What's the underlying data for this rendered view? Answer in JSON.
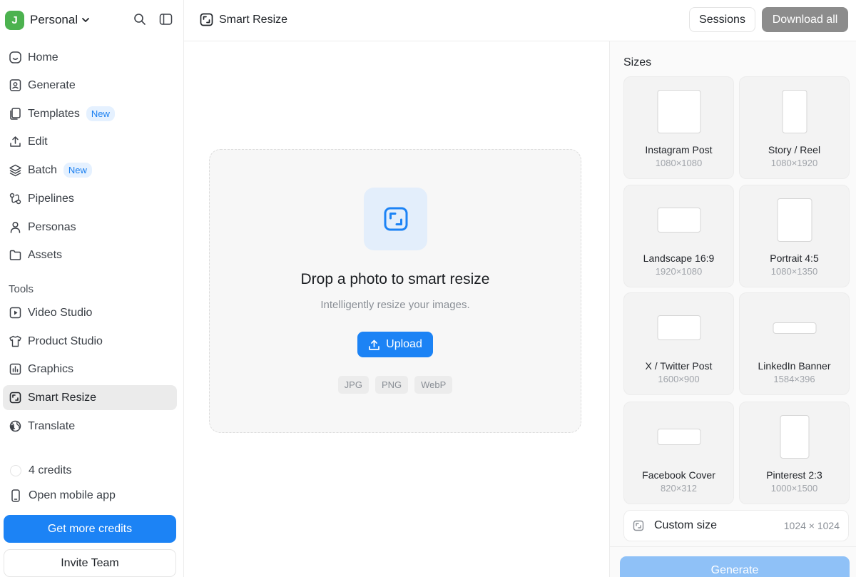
{
  "workspace": {
    "avatar_letter": "J",
    "name": "Personal"
  },
  "sidebar": {
    "nav": [
      {
        "label": "Home",
        "icon": "home-icon"
      },
      {
        "label": "Generate",
        "icon": "image-icon"
      },
      {
        "label": "Templates",
        "icon": "templates-icon",
        "badge": "New"
      },
      {
        "label": "Edit",
        "icon": "upload-icon"
      },
      {
        "label": "Batch",
        "icon": "layers-icon",
        "badge": "New"
      },
      {
        "label": "Pipelines",
        "icon": "pipeline-icon"
      },
      {
        "label": "Personas",
        "icon": "person-icon"
      },
      {
        "label": "Assets",
        "icon": "folder-icon"
      }
    ],
    "tools_label": "Tools",
    "tools": [
      {
        "label": "Video Studio",
        "icon": "play-icon"
      },
      {
        "label": "Product Studio",
        "icon": "shirt-icon"
      },
      {
        "label": "Graphics",
        "icon": "bar-chart-icon"
      },
      {
        "label": "Smart Resize",
        "icon": "resize-icon",
        "active": true
      },
      {
        "label": "Translate",
        "icon": "globe-icon"
      }
    ],
    "credits": "4 credits",
    "mobile_app": "Open mobile app",
    "get_credits": "Get more credits",
    "invite": "Invite Team"
  },
  "header": {
    "title": "Smart Resize",
    "sessions": "Sessions",
    "download_all": "Download all"
  },
  "dropzone": {
    "title": "Drop a photo to smart resize",
    "subtitle": "Intelligently resize your images.",
    "upload": "Upload",
    "formats": [
      "JPG",
      "PNG",
      "WebP"
    ]
  },
  "sizes": {
    "title": "Sizes",
    "items": [
      {
        "name": "Instagram Post",
        "dim": "1080×1080"
      },
      {
        "name": "Story / Reel",
        "dim": "1080×1920"
      },
      {
        "name": "Landscape 16:9",
        "dim": "1920×1080"
      },
      {
        "name": "Portrait 4:5",
        "dim": "1080×1350"
      },
      {
        "name": "X / Twitter Post",
        "dim": "1600×900"
      },
      {
        "name": "LinkedIn Banner",
        "dim": "1584×396"
      },
      {
        "name": "Facebook Cover",
        "dim": "820×312"
      },
      {
        "name": "Pinterest 2:3",
        "dim": "1000×1500"
      }
    ],
    "custom_label": "Custom size",
    "custom_value": "1024 × 1024",
    "generate": "Generate"
  },
  "colors": {
    "accent": "#1c83f5",
    "accent_disabled": "#8fc1f7",
    "workspace_avatar": "#4cb24f",
    "badge_bg": "#e5f1ff",
    "badge_text": "#1a7ff0"
  }
}
